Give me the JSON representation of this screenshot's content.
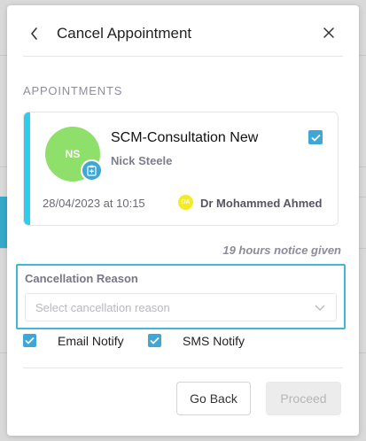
{
  "modal": {
    "title": "Cancel Appointment"
  },
  "appointments": {
    "section_label": "APPOINTMENTS",
    "items": [
      {
        "initials": "NS",
        "title": "SCM-Consultation New",
        "client": "Nick Steele",
        "datetime": "28/04/2023 at 10:15",
        "practitioner_initials": "DA",
        "practitioner": "Dr Mohammed Ahmed",
        "checked": true
      }
    ]
  },
  "notice": "19 hours notice given",
  "cancellation": {
    "label": "Cancellation Reason",
    "placeholder": "Select cancellation reason"
  },
  "notify": {
    "email_label": "Email Notify",
    "email_checked": true,
    "sms_label": "SMS Notify",
    "sms_checked": true
  },
  "footer": {
    "back_label": "Go Back",
    "proceed_label": "Proceed"
  },
  "colors": {
    "accent": "#3ea7d6",
    "card_bar": "#2ecdf0",
    "avatar": "#8fe06a",
    "practitioner_badge": "#f3ea2a",
    "highlight_border": "#43b6d6"
  },
  "icons": {
    "back": "chevron-left-icon",
    "close": "close-icon",
    "avatar_badge": "clipboard-medical-icon",
    "select": "chevron-down-icon",
    "check": "check-icon"
  }
}
